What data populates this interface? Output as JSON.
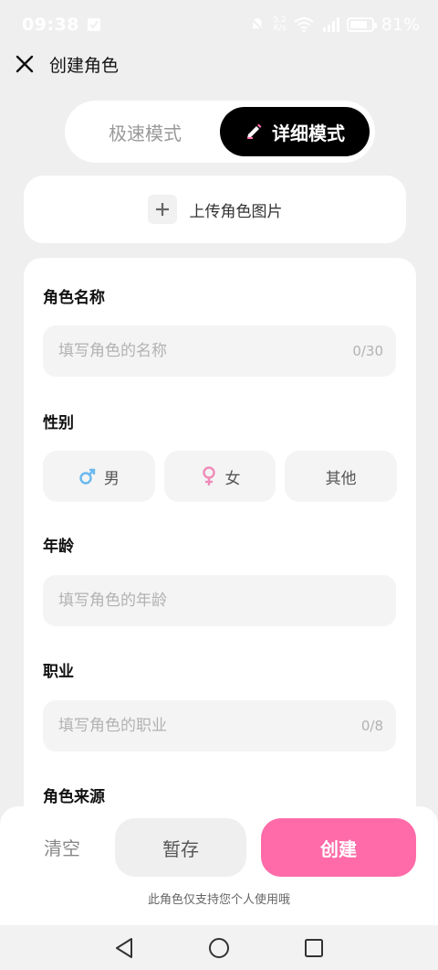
{
  "status_bar": {
    "time": "09:38",
    "net_speed": "5.2\nK/s",
    "battery": "81%",
    "battery_level": 0.81
  },
  "header": {
    "title": "创建角色",
    "close_icon": "close-icon"
  },
  "mode_toggle": {
    "fast_label": "极速模式",
    "detail_label": "详细模式",
    "active": "detail"
  },
  "upload": {
    "label": "上传角色图片"
  },
  "form": {
    "name": {
      "label": "角色名称",
      "placeholder": "填写角色的名称",
      "counter": "0/30"
    },
    "gender": {
      "label": "性别",
      "options": [
        {
          "label": "男",
          "color": "#6ab8f0"
        },
        {
          "label": "女",
          "color": "#f08bb8"
        },
        {
          "label": "其他"
        }
      ]
    },
    "age": {
      "label": "年龄",
      "placeholder": "填写角色的年龄"
    },
    "job": {
      "label": "职业",
      "placeholder": "填写角色的职业",
      "counter": "0/8"
    },
    "source": {
      "label": "角色来源"
    }
  },
  "bottom": {
    "clear_label": "清空",
    "draft_label": "暂存",
    "create_label": "创建",
    "notice": "此角色仅支持您个人使用哦",
    "accent_color": "#fe6ba8"
  }
}
